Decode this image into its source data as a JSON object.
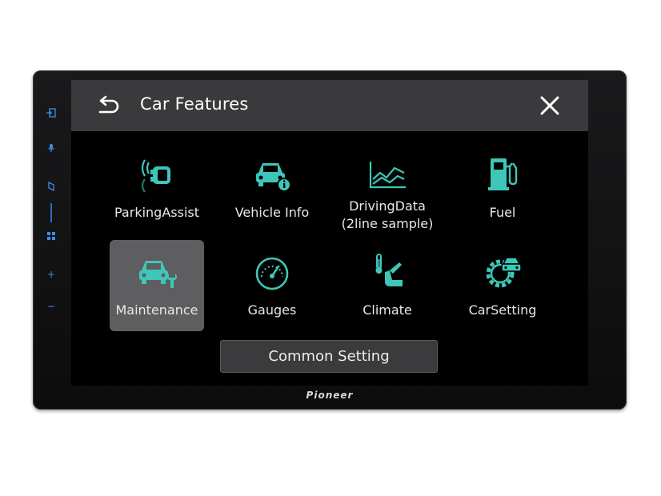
{
  "header": {
    "title": "Car Features"
  },
  "features": [
    {
      "label": "ParkingAssist",
      "icon": "parking-assist-icon"
    },
    {
      "label": "Vehicle Info",
      "icon": "vehicle-info-icon"
    },
    {
      "label": "DrivingData",
      "label2": "(2line sample)",
      "icon": "driving-data-icon"
    },
    {
      "label": "Fuel",
      "icon": "fuel-icon"
    },
    {
      "label": "Maintenance",
      "icon": "maintenance-icon",
      "selected": true
    },
    {
      "label": "Gauges",
      "icon": "gauges-icon"
    },
    {
      "label": "Climate",
      "icon": "climate-icon"
    },
    {
      "label": "CarSetting",
      "icon": "car-setting-icon"
    }
  ],
  "footer": {
    "common_setting_label": "Common Setting"
  },
  "device": {
    "brand": "Pioneer",
    "side_buttons": {
      "plus": "+",
      "minus": "−"
    }
  },
  "colors": {
    "accent": "#3ec7b8",
    "title_bar": "#3a3a3c",
    "selected_tile": "#5e5e60",
    "side_button": "#3d8fe6"
  }
}
